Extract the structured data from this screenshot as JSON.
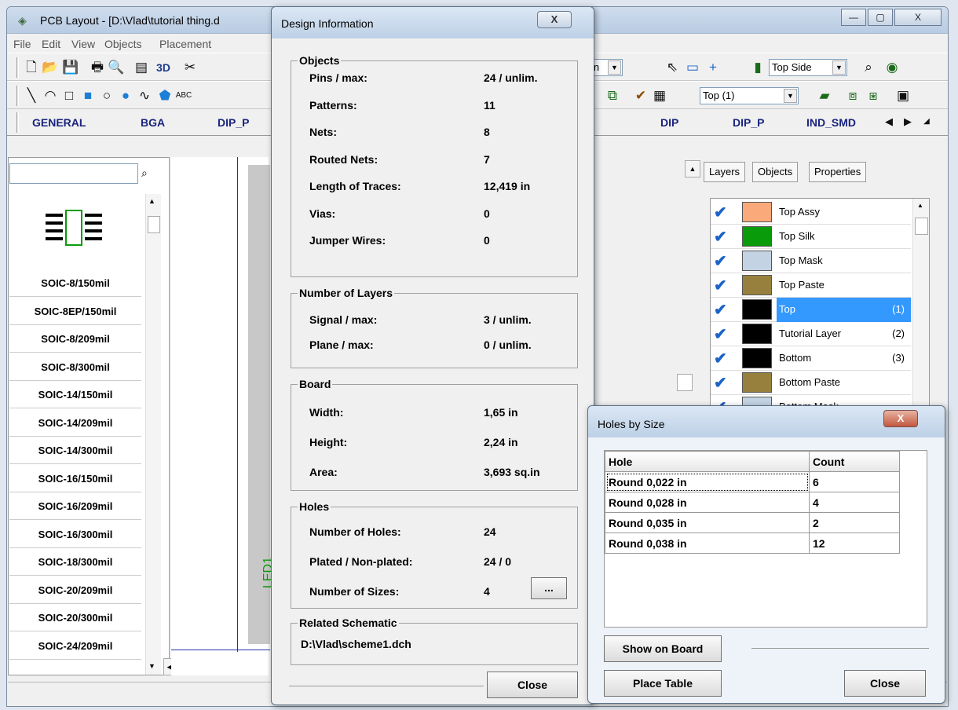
{
  "main": {
    "title": "PCB Layout - [D:\\Vlad\\tutorial thing.d",
    "menu": [
      "File",
      "Edit",
      "View",
      "Objects",
      "Placement"
    ],
    "toolbar": {
      "units": "in",
      "side": "Top Side",
      "layer": "Top (1)",
      "three_d": "3D",
      "text_tool": "ABC"
    },
    "libtabs": [
      "GENERAL",
      "BGA",
      "DIP_P",
      "DIP",
      "DIP_P",
      "IND_SMD"
    ],
    "patterns": [
      "SOIC-8/150mil",
      "SOIC-8EP/150mil",
      "SOIC-8/209mil",
      "SOIC-8/300mil",
      "SOIC-14/150mil",
      "SOIC-14/209mil",
      "SOIC-14/300mil",
      "SOIC-16/150mil",
      "SOIC-16/209mil",
      "SOIC-16/300mil",
      "SOIC-18/300mil",
      "SOIC-20/209mil",
      "SOIC-20/300mil",
      "SOIC-24/209mil"
    ],
    "layer_tabs": [
      "Layers",
      "Objects",
      "Properties"
    ],
    "layers": [
      {
        "name": "Top Assy",
        "color": "#f9a97a",
        "num": ""
      },
      {
        "name": "Top Silk",
        "color": "#0a9b0a",
        "num": ""
      },
      {
        "name": "Top Mask",
        "color": "#c4d3e3",
        "num": ""
      },
      {
        "name": "Top Paste",
        "color": "#97803e",
        "num": ""
      },
      {
        "name": "Top",
        "color": "#000000",
        "num": "(1)"
      },
      {
        "name": "Tutorial Layer",
        "color": "#000000",
        "num": "(2)"
      },
      {
        "name": "Bottom",
        "color": "#000000",
        "num": "(3)"
      },
      {
        "name": "Bottom Paste",
        "color": "#97803e",
        "num": ""
      },
      {
        "name": "Bottom Mask",
        "color": "#c4d3e3",
        "num": ""
      }
    ],
    "canvas_label": "LED1"
  },
  "design_info": {
    "title": "Design Information",
    "close_glyph": "X",
    "objects": {
      "label": "Objects",
      "rows": [
        {
          "k": "Pins / max:",
          "v": "24 / unlim."
        },
        {
          "k": "Patterns:",
          "v": "11"
        },
        {
          "k": "Nets:",
          "v": "8"
        },
        {
          "k": "Routed Nets:",
          "v": "7"
        },
        {
          "k": "Length of Traces:",
          "v": "12,419 in"
        },
        {
          "k": "Vias:",
          "v": "0"
        },
        {
          "k": "Jumper Wires:",
          "v": "0"
        }
      ]
    },
    "layers": {
      "label": "Number of Layers",
      "rows": [
        {
          "k": "Signal / max:",
          "v": "3 / unlim."
        },
        {
          "k": "Plane / max:",
          "v": "0 / unlim."
        }
      ]
    },
    "board": {
      "label": "Board",
      "rows": [
        {
          "k": "Width:",
          "v": "1,65 in"
        },
        {
          "k": "Height:",
          "v": "2,24 in"
        },
        {
          "k": "Area:",
          "v": "3,693 sq.in"
        }
      ]
    },
    "holes": {
      "label": "Holes",
      "rows": [
        {
          "k": "Number of Holes:",
          "v": "24"
        },
        {
          "k": "Plated / Non-plated:",
          "v": "24 / 0"
        },
        {
          "k": "Number of Sizes:",
          "v": "4"
        }
      ],
      "more": "..."
    },
    "schematic": {
      "label": "Related Schematic",
      "value": "D:\\Vlad\\scheme1.dch"
    },
    "close": "Close"
  },
  "holes_by_size": {
    "title": "Holes by Size",
    "close_glyph": "X",
    "columns": [
      "Hole",
      "Count"
    ],
    "rows": [
      [
        "Round 0,022 in",
        "6"
      ],
      [
        "Round 0,028 in",
        "4"
      ],
      [
        "Round 0,035 in",
        "2"
      ],
      [
        "Round 0,038 in",
        "12"
      ]
    ],
    "show_on_board": "Show on Board",
    "place_table": "Place Table",
    "close": "Close"
  }
}
